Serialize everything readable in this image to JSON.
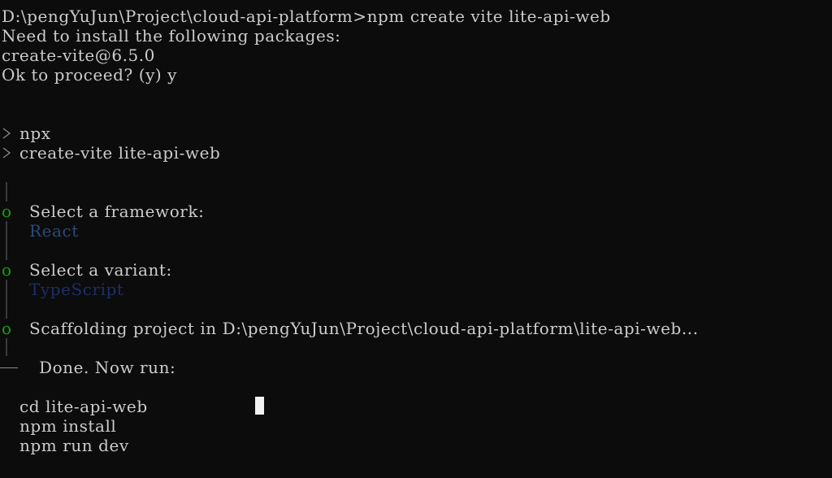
{
  "terminal": {
    "lines": {
      "cmd": "D:\\pengYuJun\\Project\\cloud-api-platform>npm create vite lite-api-web",
      "need_install": "Need to install the following packages:",
      "package": "create-vite@6.5.0",
      "proceed": "Ok to proceed? (y) y",
      "npx": "npx",
      "create_vite": "create-vite lite-api-web",
      "select_framework": "Select a framework:",
      "framework_value": "React",
      "select_variant": "Select a variant:",
      "variant_value": "TypeScript",
      "scaffolding": "Scaffolding project in D:\\pengYuJun\\Project\\cloud-api-platform\\lite-api-web...",
      "done": "Done. Now run:",
      "cd": "cd lite-api-web",
      "npm_install": "npm install",
      "npm_run_dev": "npm run dev"
    },
    "markers": {
      "step": "o",
      "prompt": ">"
    },
    "colors": {
      "background": "#0c0c0c",
      "foreground": "#cccccc",
      "step_marker": "#13a10e",
      "framework_value": "#2c4a77",
      "variant_value": "#1b2f6b",
      "cursor": "#f2f2f2"
    }
  }
}
